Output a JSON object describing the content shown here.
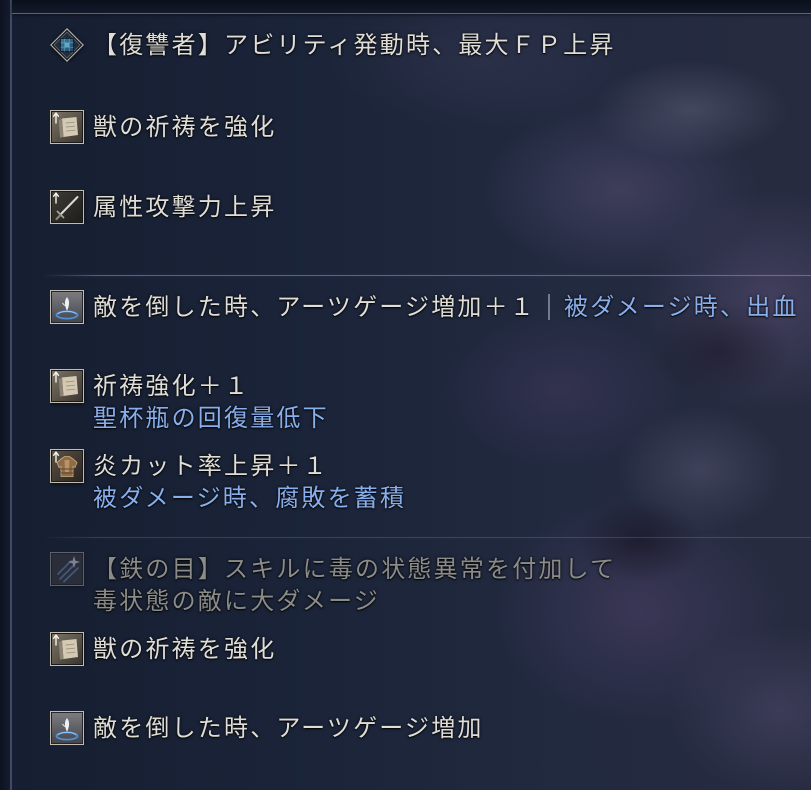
{
  "colors": {
    "text": "#dfddd6",
    "curse": "#88aeeb",
    "disabled": "#8b8b88",
    "separator": "#8f95a4",
    "divider": "#8a9bbd"
  },
  "groups": [
    {
      "effects": [
        {
          "icon": "diamond-emblem-icon",
          "text": "【復讐者】アビリティ発動時、最大ＦＰ上昇"
        },
        {
          "icon": "prayer-scroll-icon",
          "text": "獣の祈祷を強化"
        },
        {
          "icon": "sword-icon",
          "text": "属性攻撃力上昇"
        }
      ]
    },
    {
      "effects": [
        {
          "icon": "arts-swirl-icon",
          "text": "敵を倒した時、アーツゲージ増加＋１",
          "curse": "被ダメージ時、出血"
        },
        {
          "icon": "prayer-scroll-icon",
          "text": "祈祷強化＋１",
          "curse": "聖杯瓶の回復量低下"
        },
        {
          "icon": "armor-icon",
          "text": "炎カット率上昇＋１",
          "curse": "被ダメージ時、腐敗を蓄積"
        }
      ]
    },
    {
      "effects": [
        {
          "icon": "claw-icon",
          "inactive": true,
          "text_lines": [
            "【鉄の目】スキルに毒の状態異常を付加して",
            "毒状態の敵に大ダメージ"
          ]
        },
        {
          "icon": "prayer-scroll-icon",
          "text": "獣の祈祷を強化"
        },
        {
          "icon": "arts-swirl-icon",
          "text": "敵を倒した時、アーツゲージ増加"
        }
      ]
    }
  ]
}
